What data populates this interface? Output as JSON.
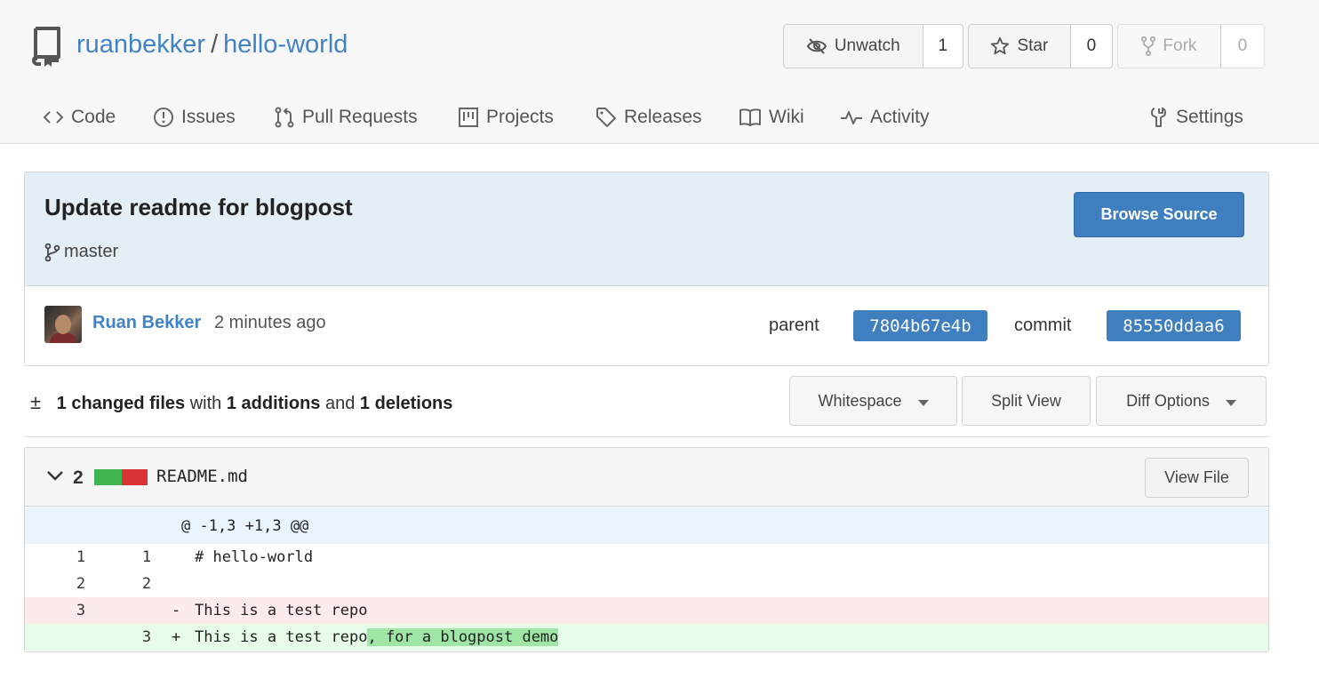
{
  "repo": {
    "owner": "ruanbekker",
    "separator": "/",
    "name": "hello-world"
  },
  "actions": {
    "watch": {
      "label": "Unwatch",
      "count": "1"
    },
    "star": {
      "label": "Star",
      "count": "0"
    },
    "fork": {
      "label": "Fork",
      "count": "0"
    }
  },
  "nav": {
    "code": "Code",
    "issues": "Issues",
    "pull_requests": "Pull Requests",
    "projects": "Projects",
    "releases": "Releases",
    "wiki": "Wiki",
    "activity": "Activity",
    "settings": "Settings"
  },
  "commit": {
    "title": "Update readme for blogpost",
    "branch": "master",
    "browse_label": "Browse Source",
    "author": "Ruan Bekker",
    "time_ago": "2 minutes ago",
    "parent_label": "parent",
    "parent_sha": "7804b67e4b",
    "commit_label": "commit",
    "commit_sha": "85550ddaa6"
  },
  "stats": {
    "symbol": "±",
    "changed": "1 changed files",
    "with": "with",
    "additions": "1 additions",
    "and": "and",
    "deletions": "1 deletions"
  },
  "toolbar": {
    "whitespace": "Whitespace",
    "split_view": "Split View",
    "diff_options": "Diff Options"
  },
  "file": {
    "change_count": "2",
    "name": "README.md",
    "view_file": "View File",
    "colors": {
      "addition": "#3fb34f",
      "deletion": "#db3333"
    }
  },
  "diff": {
    "hunk_header": "@ -1,3 +1,3 @@",
    "rows": [
      {
        "old": "1",
        "new": "1",
        "sign": "",
        "code": "# hello-world"
      },
      {
        "old": "2",
        "new": "2",
        "sign": "",
        "code": ""
      },
      {
        "old": "3",
        "new": "",
        "sign": "-",
        "code": "This is a test repo"
      },
      {
        "old": "",
        "new": "3",
        "sign": "+",
        "code_plain": "This is a test repo",
        "code_added": ", for a blogpost demo"
      }
    ]
  }
}
